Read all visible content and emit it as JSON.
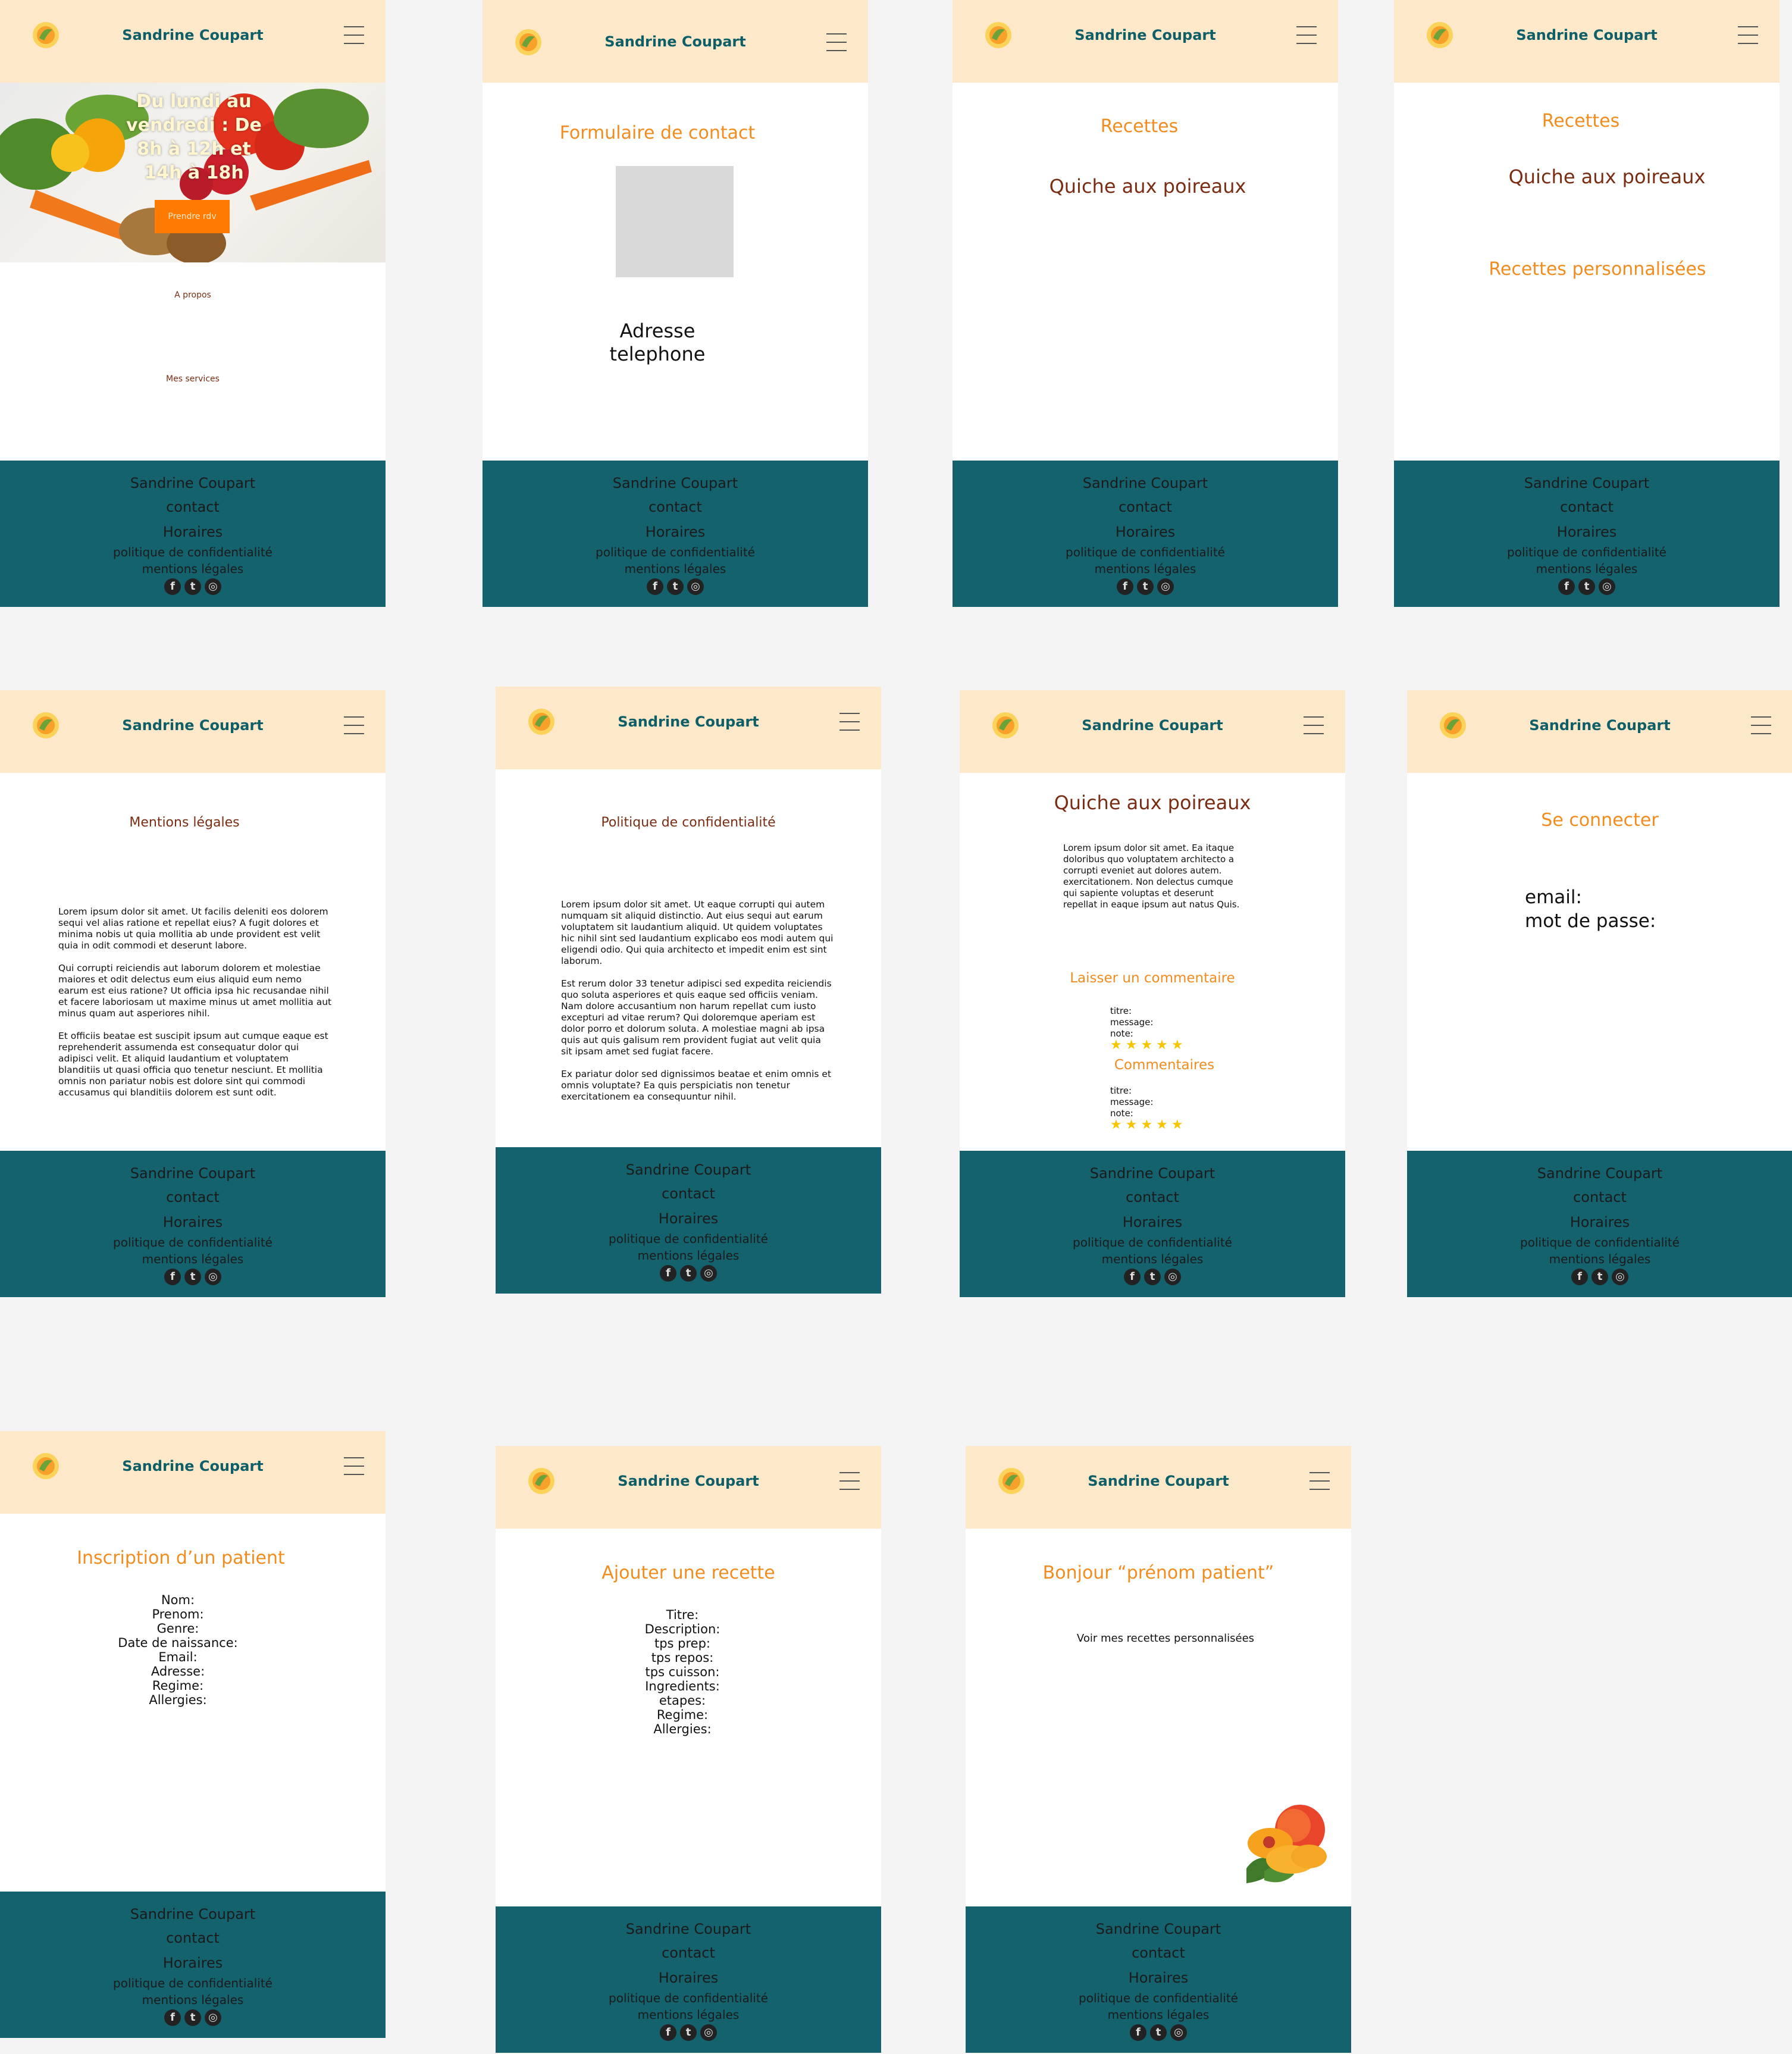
{
  "brand": "Sandrine Coupart",
  "colors": {
    "header_bg": "#fde9c9",
    "footer_bg": "#14626e",
    "accent_orange": "#f28c1f",
    "accent_brown": "#7a2d12",
    "button_orange": "#ff7a00",
    "brand_teal": "#0f5f69"
  },
  "icons": [
    "logo-icon",
    "menu-icon",
    "facebook-icon",
    "twitter-icon",
    "instagram-icon"
  ],
  "footer": {
    "name": "Sandrine Coupart",
    "contact": "contact",
    "horaires": "Horaires",
    "privacy": "politique de confidentialité",
    "legal": "mentions légales"
  },
  "home": {
    "hero_hours": "Du lundi au vendredi : De 8h à 12h et 14h à 18h",
    "cta": "Prendre rdv",
    "about": "A propos",
    "services": "Mes services"
  },
  "contact": {
    "title": "Formulaire de contact",
    "address": "Adresse",
    "phone": "telephone"
  },
  "recettes1": {
    "title": "Recettes",
    "recipe": "Quiche aux poireaux"
  },
  "recettes2": {
    "title": "Recettes",
    "recipe": "Quiche aux poireaux",
    "personal": "Recettes personnalisées"
  },
  "mentions": {
    "title": "Mentions légales",
    "p1": "Lorem ipsum dolor sit amet. Ut facilis deleniti eos dolorem sequi vel alias ratione et repellat eius? A fugit dolores et minima nobis ut quia mollitia ab unde provident est velit quia in odit commodi et deserunt labore.",
    "p2": "Qui corrupti reiciendis aut laborum dolorem et molestiae maiores et odit delectus eum eius aliquid eum nemo earum est eius ratione? Ut officia ipsa hic recusandae nihil et facere laboriosam ut maxime minus ut amet mollitia aut minus quam aut asperiores nihil.",
    "p3": "Et officiis beatae est suscipit ipsum aut cumque eaque est reprehenderit assumenda est consequatur dolor qui adipisci velit. Et aliquid laudantium et voluptatem blanditiis ut quasi officia quo tenetur nesciunt. Et mollitia omnis non pariatur nobis est dolore sint qui commodi accusamus qui blanditiis dolorem est sunt odit."
  },
  "politique": {
    "title": "Politique de confidentialité",
    "p1": "Lorem ipsum dolor sit amet. Ut eaque corrupti qui autem numquam sit aliquid distinctio. Aut eius sequi aut earum voluptatem sit laudantium aliquid. Ut quidem voluptates hic nihil sint sed laudantium explicabo eos modi autem qui eligendi odio. Qui quia architecto et impedit enim est sint laborum.",
    "p2": "Est rerum dolor 33 tenetur adipisci sed expedita reiciendis quo soluta asperiores et quis eaque sed officiis veniam. Nam dolore accusantium non harum repellat cum iusto excepturi ad vitae rerum? Qui doloremque aperiam est dolor porro et dolorum soluta. A molestiae magni ab ipsa quis aut quis galisum rem provident fugiat aut velit quia sit ipsam amet sed fugiat facere.",
    "p3": "Ex pariatur dolor sed dignissimos beatae et enim omnis et omnis voluptate? Ea quis perspiciatis non tenetur exercitationem ea consequuntur nihil."
  },
  "recipe_detail": {
    "title": "Quiche aux poireaux",
    "desc": "Lorem ipsum dolor sit amet. Ea itaque doloribus quo voluptatem architecto a corrupti eveniet aut dolores autem. exercitationem. Non delectus cumque qui sapiente voluptas et deserunt repellat in eaque ipsum aut natus Quis.",
    "leave": "Laisser un commentaire",
    "comments": "Commentaires",
    "titre": "titre:",
    "message": "message:",
    "note": "note:",
    "stars": "★★★★★",
    "rating_value": 5
  },
  "login": {
    "title": "Se connecter",
    "email": "email:",
    "password": "mot de passe:"
  },
  "inscription": {
    "title": "Inscription d’un patient",
    "fields": [
      "Nom:",
      "Prenom:",
      "Genre:",
      "Date de naissance:",
      "Email:",
      "Adresse:",
      "Regime:",
      "Allergies:"
    ]
  },
  "ajout": {
    "title": "Ajouter une recette",
    "fields": [
      "Titre:",
      "Description:",
      "tps prep:",
      "tps repos:",
      "tps cuisson:",
      "Ingredients:",
      "etapes:",
      "Regime:",
      "Allergies:"
    ]
  },
  "patient": {
    "title": "Bonjour “prénom patient”",
    "link": "Voir mes recettes personnalisées"
  }
}
